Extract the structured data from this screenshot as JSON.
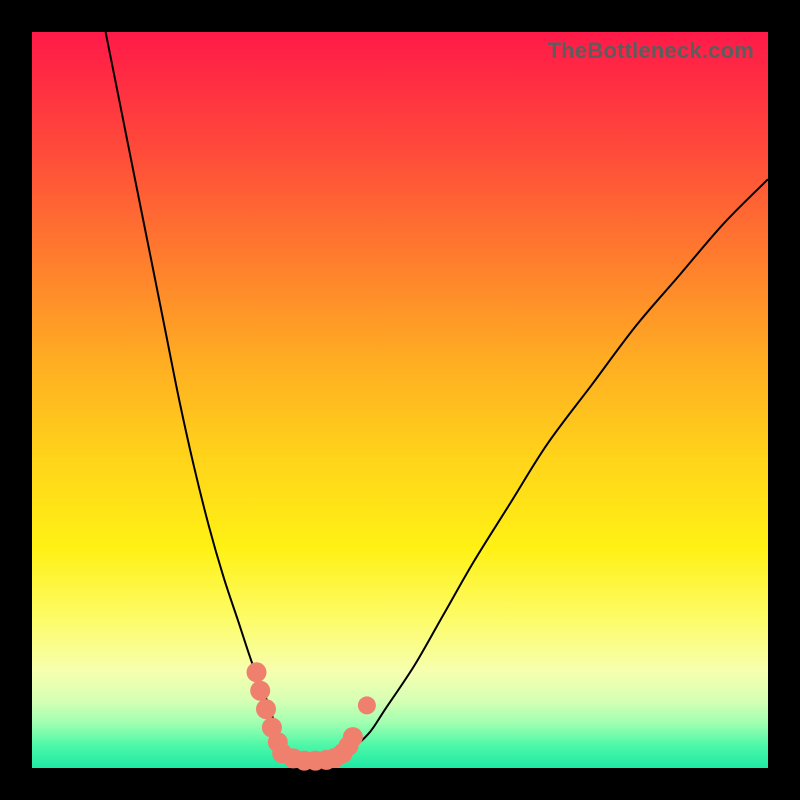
{
  "attribution": "TheBottleneck.com",
  "chart_data": {
    "type": "line",
    "title": "",
    "xlabel": "",
    "ylabel": "",
    "xlim": [
      0,
      100
    ],
    "ylim": [
      0,
      100
    ],
    "legend": false,
    "grid": false,
    "series": [
      {
        "name": "left-curve",
        "x": [
          10,
          12,
          14,
          16,
          18,
          20,
          22,
          24,
          26,
          28,
          30,
          32,
          33,
          34,
          35,
          36
        ],
        "y": [
          100,
          90,
          80,
          70,
          60,
          50,
          41,
          33,
          26,
          20,
          14,
          9,
          6,
          4,
          2.5,
          1.5
        ]
      },
      {
        "name": "right-curve",
        "x": [
          42,
          44,
          46,
          48,
          52,
          56,
          60,
          65,
          70,
          76,
          82,
          88,
          94,
          100
        ],
        "y": [
          1.5,
          3,
          5,
          8,
          14,
          21,
          28,
          36,
          44,
          52,
          60,
          67,
          74,
          80
        ]
      },
      {
        "name": "markers-left",
        "x": [
          30.5,
          31,
          31.8,
          32.6,
          33.4
        ],
        "y": [
          13,
          10.5,
          8,
          5.5,
          3.5
        ]
      },
      {
        "name": "markers-bottom",
        "x": [
          34,
          35.5,
          37,
          38.5,
          40,
          41.2,
          42.2,
          43,
          43.6
        ],
        "y": [
          2,
          1.3,
          1,
          1,
          1.1,
          1.4,
          2,
          3,
          4.2
        ]
      },
      {
        "name": "marker-right-outlier",
        "x": [
          45.5
        ],
        "y": [
          8.5
        ]
      }
    ],
    "marker_color": "#f0806e",
    "line_color": "#000000"
  }
}
